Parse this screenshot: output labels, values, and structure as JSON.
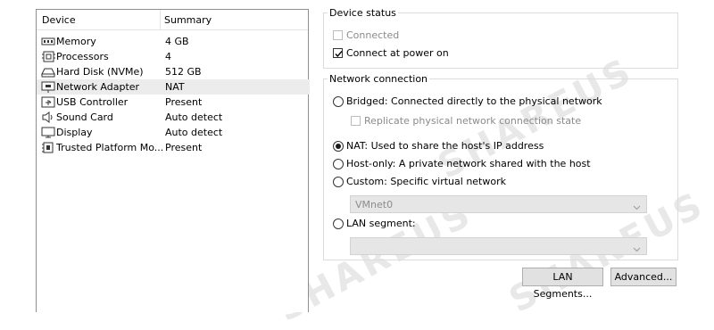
{
  "device_list": {
    "headers": {
      "device": "Device",
      "summary": "Summary"
    },
    "rows": [
      {
        "name": "Memory",
        "summary": "4 GB",
        "icon": "memory-icon",
        "selected": false
      },
      {
        "name": "Processors",
        "summary": "4",
        "icon": "processor-icon",
        "selected": false
      },
      {
        "name": "Hard Disk (NVMe)",
        "summary": "512 GB",
        "icon": "hard-disk-icon",
        "selected": false
      },
      {
        "name": "Network Adapter",
        "summary": "NAT",
        "icon": "network-adapter-icon",
        "selected": true
      },
      {
        "name": "USB Controller",
        "summary": "Present",
        "icon": "usb-icon",
        "selected": false
      },
      {
        "name": "Sound Card",
        "summary": "Auto detect",
        "icon": "speaker-icon",
        "selected": false
      },
      {
        "name": "Display",
        "summary": "Auto detect",
        "icon": "monitor-icon",
        "selected": false
      },
      {
        "name": "Trusted Platform Mo...",
        "summary": "Present",
        "icon": "tpm-icon",
        "selected": false
      }
    ]
  },
  "device_status": {
    "legend": "Device status",
    "connected": {
      "label": "Connected",
      "checked": false,
      "enabled": false
    },
    "connect_at_power_on": {
      "label": "Connect at power on",
      "checked": true,
      "enabled": true
    }
  },
  "network_connection": {
    "legend": "Network connection",
    "bridged": {
      "label": "Bridged: Connected directly to the physical network",
      "selected": false
    },
    "replicate": {
      "label": "Replicate physical network connection state",
      "checked": false,
      "enabled": false
    },
    "nat": {
      "label": "NAT: Used to share the host's IP address",
      "selected": true
    },
    "host_only": {
      "label": "Host-only: A private network shared with the host",
      "selected": false
    },
    "custom": {
      "label": "Custom: Specific virtual network",
      "selected": false
    },
    "custom_select_value": "VMnet0",
    "lan_segment": {
      "label": "LAN segment:",
      "selected": false
    },
    "lan_segment_select_value": ""
  },
  "buttons": {
    "lan_segments": "LAN Segments...",
    "advanced": "Advanced..."
  },
  "watermark": "SHAREUS"
}
